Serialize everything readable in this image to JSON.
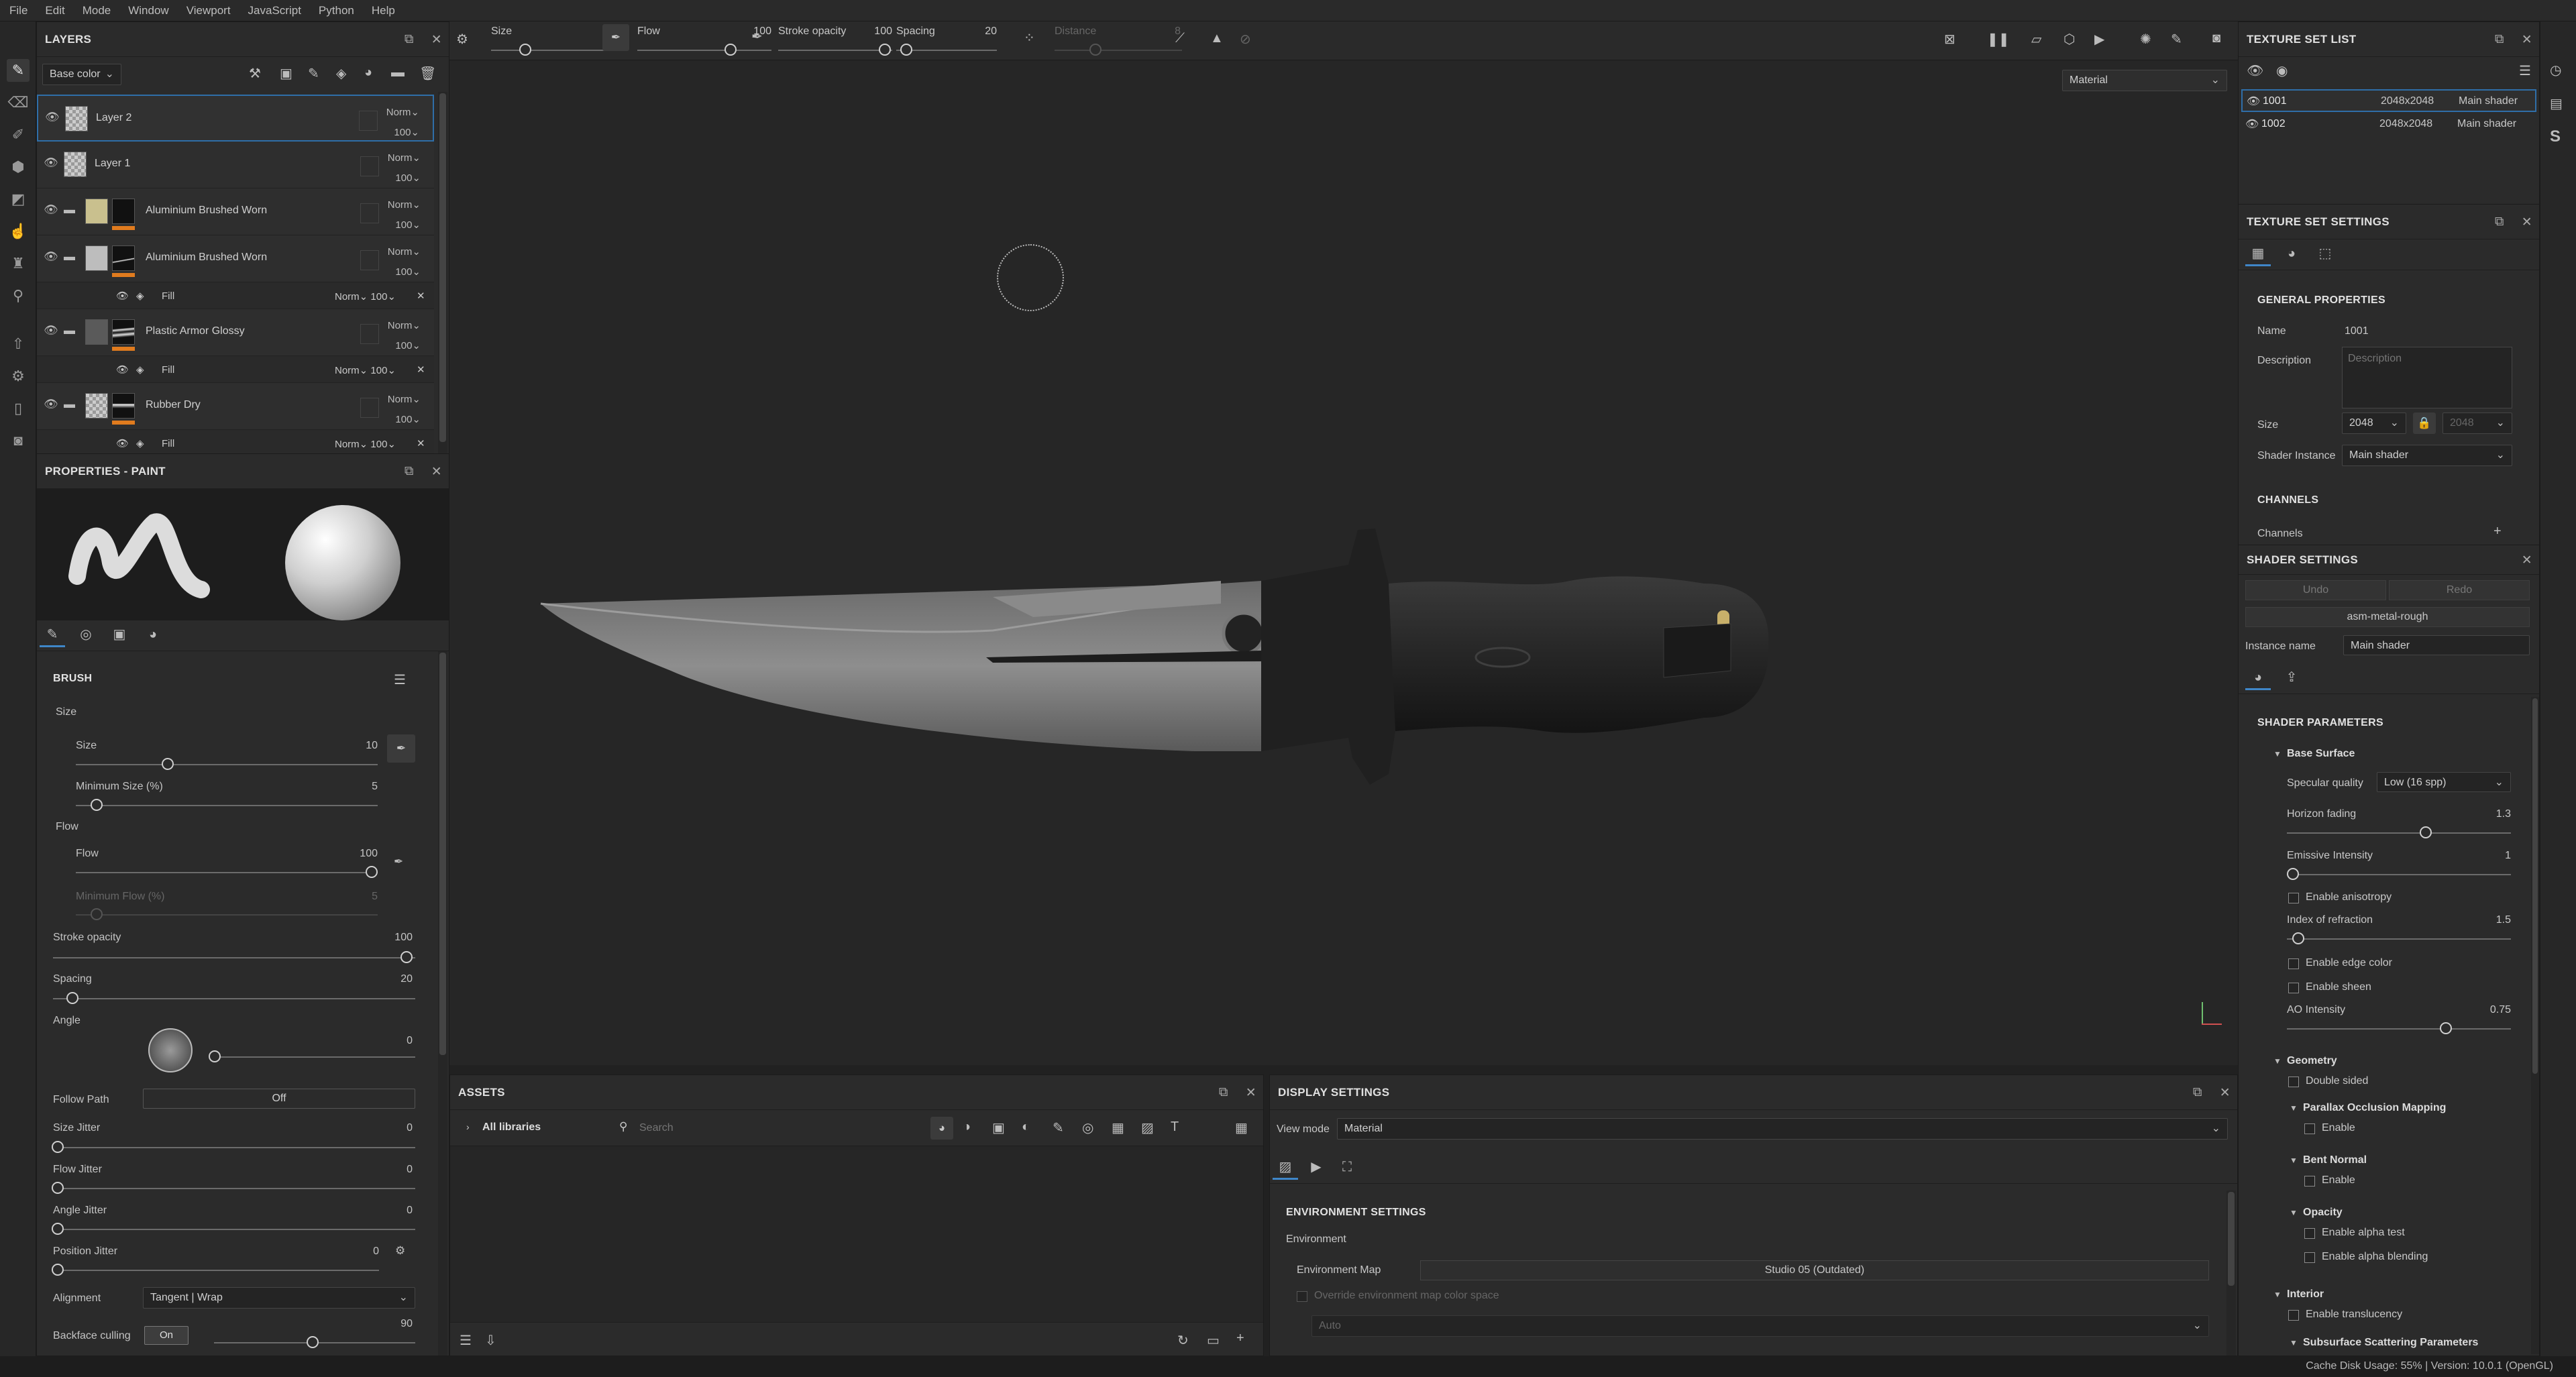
{
  "menu": [
    "File",
    "Edit",
    "Mode",
    "Window",
    "Viewport",
    "JavaScript",
    "Python",
    "Help"
  ],
  "layers_panel": {
    "title": "LAYERS",
    "channel_select": "Base color",
    "layers": [
      {
        "name": "Layer 2",
        "blend": "Norm",
        "opacity": "100"
      },
      {
        "name": "Layer 1",
        "blend": "Norm",
        "opacity": "100"
      },
      {
        "name": "Aluminium Brushed Worn",
        "blend": "Norm",
        "opacity": "100"
      },
      {
        "name": "Aluminium Brushed Worn",
        "blend": "Norm",
        "opacity": "100"
      },
      {
        "name": "Plastic Armor Glossy",
        "blend": "Norm",
        "opacity": "100"
      },
      {
        "name": "Rubber Dry",
        "blend": "Norm",
        "opacity": "100"
      }
    ],
    "fill_rows": [
      {
        "name": "Fill",
        "blend": "Norm",
        "opacity": "100"
      },
      {
        "name": "Fill",
        "blend": "Norm",
        "opacity": "100"
      },
      {
        "name": "Fill",
        "blend": "Norm",
        "opacity": "100"
      }
    ]
  },
  "properties": {
    "title": "PROPERTIES - PAINT",
    "brush_title": "BRUSH",
    "size_group": "Size",
    "size_label": "Size",
    "size_value": "10",
    "min_size_label": "Minimum Size (%)",
    "min_size_value": "5",
    "flow_group": "Flow",
    "flow_label": "Flow",
    "flow_value": "100",
    "min_flow_label": "Minimum Flow (%)",
    "min_flow_value": "5",
    "stroke_opacity_label": "Stroke opacity",
    "stroke_opacity_value": "100",
    "spacing_label": "Spacing",
    "spacing_value": "20",
    "angle_label": "Angle",
    "angle_value": "0",
    "follow_path_label": "Follow Path",
    "follow_path_value": "Off",
    "size_jitter_label": "Size Jitter",
    "size_jitter_value": "0",
    "flow_jitter_label": "Flow Jitter",
    "flow_jitter_value": "0",
    "angle_jitter_label": "Angle Jitter",
    "angle_jitter_value": "0",
    "position_jitter_label": "Position Jitter",
    "position_jitter_value": "0",
    "alignment_label": "Alignment",
    "alignment_value": "Tangent | Wrap",
    "backface_label": "Backface culling",
    "backface_toggle": "On",
    "backface_value": "90"
  },
  "toolbar": {
    "size_label": "Size",
    "size_value": "10",
    "flow_label": "Flow",
    "flow_value": "100",
    "stroke_label": "Stroke opacity",
    "stroke_value": "100",
    "spacing_label": "Spacing",
    "spacing_value": "20",
    "distance_label": "Distance",
    "distance_value": "8"
  },
  "viewport": {
    "mode": "Material"
  },
  "texture_set_list": {
    "title": "TEXTURE SET LIST",
    "rows": [
      {
        "name": "1001",
        "res": "2048x2048",
        "shader": "Main shader"
      },
      {
        "name": "1002",
        "res": "2048x2048",
        "shader": "Main shader"
      }
    ]
  },
  "texture_set_settings": {
    "title": "TEXTURE SET SETTINGS",
    "general": "GENERAL PROPERTIES",
    "name_label": "Name",
    "name_value": "1001",
    "desc_label": "Description",
    "desc_placeholder": "Description",
    "size_label": "Size",
    "size_value": "2048",
    "size_value2": "2048",
    "shader_label": "Shader Instance",
    "shader_value": "Main shader",
    "channels_title": "CHANNELS",
    "channels_label": "Channels"
  },
  "shader_settings": {
    "title": "SHADER SETTINGS",
    "undo": "Undo",
    "redo": "Redo",
    "shader_name": "asm-metal-rough",
    "instance_label": "Instance name",
    "instance_value": "Main shader",
    "params_title": "SHADER PARAMETERS",
    "base_surface": "Base Surface",
    "spec_label": "Specular quality",
    "spec_value": "Low (16 spp)",
    "horizon_label": "Horizon fading",
    "horizon_value": "1.3",
    "emissive_label": "Emissive Intensity",
    "emissive_value": "1",
    "aniso_label": "Enable anisotropy",
    "ior_label": "Index of refraction",
    "ior_value": "1.5",
    "edge_label": "Enable edge color",
    "sheen_label": "Enable sheen",
    "ao_label": "AO Intensity",
    "ao_value": "0.75",
    "geometry": "Geometry",
    "double_sided": "Double sided",
    "pom": "Parallax Occlusion Mapping",
    "pom_enable": "Enable",
    "bent": "Bent Normal",
    "bent_enable": "Enable",
    "opacity": "Opacity",
    "alpha_test": "Enable alpha test",
    "alpha_blend": "Enable alpha blending",
    "interior": "Interior",
    "translucency": "Enable translucency",
    "sss": "Subsurface Scattering Parameters"
  },
  "assets": {
    "title": "ASSETS",
    "all_libraries": "All libraries",
    "search_placeholder": "Search"
  },
  "display_settings": {
    "title": "DISPLAY SETTINGS",
    "view_mode_label": "View mode",
    "view_mode_value": "Material",
    "env_title": "ENVIRONMENT SETTINGS",
    "env_label": "Environment",
    "env_map_label": "Environment Map",
    "env_map_value": "Studio 05 (Outdated)",
    "override_label": "Override environment map color space",
    "auto_value": "Auto"
  },
  "status": {
    "text": "Cache Disk Usage:   55% | Version: 10.0.1 (OpenGL)"
  },
  "colors": {
    "accent": "#3f86c8",
    "layer_marker": "#e07b1e",
    "background": "#212121",
    "panel": "#2b2b2b"
  }
}
